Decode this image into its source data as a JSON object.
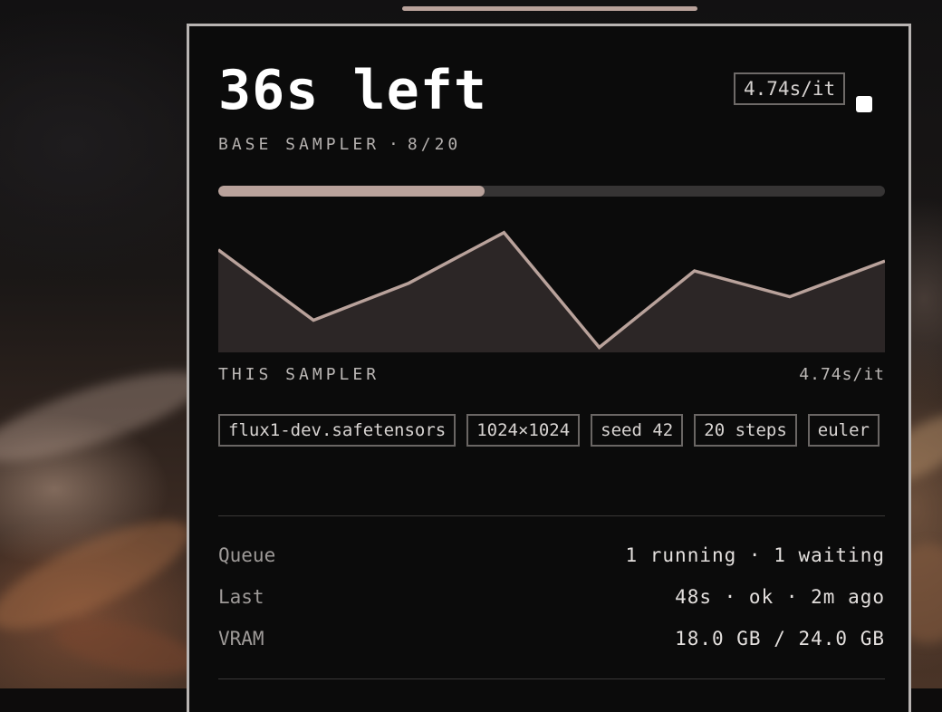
{
  "progress": {
    "eta": "36s left",
    "rate_badge": "4.74s/it",
    "stage_name": "BASE SAMPLER",
    "stage_sep": "·",
    "stage_count": "8/20",
    "fraction": 0.4
  },
  "sampler_chart": {
    "label": "THIS SAMPLER",
    "rate": "4.74s/it",
    "line_color": "#b9a29b",
    "fill_color": "#2c2626",
    "chart_data": {
      "type": "area",
      "x": [
        1,
        2,
        3,
        4,
        5,
        6,
        7,
        8
      ],
      "values": [
        0.83,
        0.26,
        0.56,
        0.97,
        0.04,
        0.66,
        0.45,
        0.74
      ],
      "ylim": [
        0,
        1.1
      ]
    }
  },
  "tags": [
    "flux1-dev.safetensors",
    "1024×1024",
    "seed 42",
    "20 steps",
    "euler"
  ],
  "stats": [
    {
      "key": "Queue",
      "value": "1 running · 1 waiting"
    },
    {
      "key": "Last",
      "value": "48s · ok · 2m ago"
    },
    {
      "key": "VRAM",
      "value": "18.0 GB / 24.0 GB"
    }
  ],
  "colors": {
    "accent": "#b9a29b",
    "card_bg": "#0b0b0b",
    "card_border": "#b8b4b2",
    "track": "#363434"
  }
}
